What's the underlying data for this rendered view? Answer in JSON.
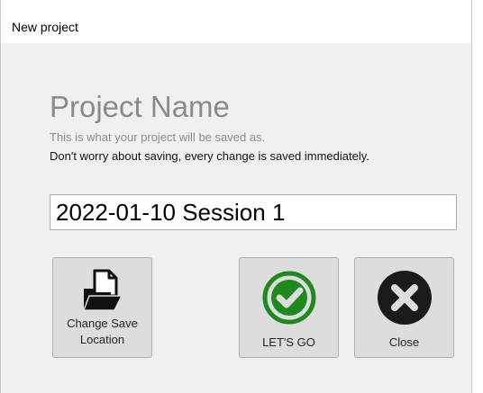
{
  "window": {
    "title": "New project"
  },
  "form": {
    "heading": "Project Name",
    "hint": "This is what your project will be saved as.",
    "note": "Don't worry about saving, every change is saved immediately.",
    "project_name_value": "2022-01-10 Session 1"
  },
  "buttons": {
    "change_save_location": {
      "label_line1": "Change Save",
      "label_line2": "Location",
      "icon": "folder-document-icon"
    },
    "lets_go": {
      "label": "LET'S GO",
      "icon": "green-checkmark-icon",
      "icon_color": "#1e8a1e"
    },
    "close": {
      "label": "Close",
      "icon": "black-x-icon",
      "icon_color": "#1a1a1a"
    }
  }
}
